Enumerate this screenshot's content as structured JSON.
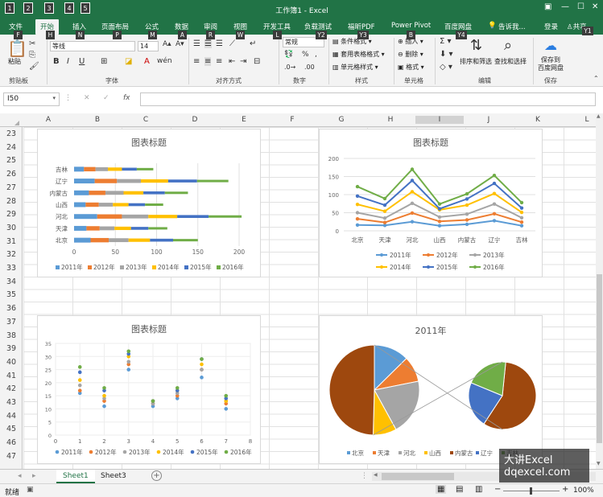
{
  "window": {
    "title": "工作簿1 - Excel",
    "quick_access_keys": [
      "1",
      "2",
      "3",
      "4",
      "5"
    ]
  },
  "tabs": [
    {
      "label": "文件",
      "key": "F"
    },
    {
      "label": "开始",
      "key": "H"
    },
    {
      "label": "插入",
      "key": "N"
    },
    {
      "label": "页面布局",
      "key": "P"
    },
    {
      "label": "公式",
      "key": "M"
    },
    {
      "label": "数据",
      "key": "A"
    },
    {
      "label": "审阅",
      "key": "R"
    },
    {
      "label": "视图",
      "key": "W"
    },
    {
      "label": "开发工具",
      "key": "L"
    },
    {
      "label": "负载测试",
      "key": "Y2"
    },
    {
      "label": "福昕PDF",
      "key": "Y3"
    },
    {
      "label": "Power Pivot",
      "key": "B"
    },
    {
      "label": "百度网盘",
      "key": "Y4"
    }
  ],
  "tell_me": "告诉我...",
  "login": "登录",
  "share": "共享",
  "share_key": "Y1",
  "ribbon": {
    "clipboard": {
      "paste": "粘贴",
      "label": "剪贴板"
    },
    "font": {
      "name": "等线",
      "size": "14",
      "label": "字体"
    },
    "align": {
      "label": "对齐方式"
    },
    "number": {
      "format": "常规",
      "label": "数字"
    },
    "styles": {
      "cond": "条件格式",
      "table": "套用表格格式",
      "cell": "单元格样式",
      "label": "样式"
    },
    "cells": {
      "insert": "插入",
      "delete": "删除",
      "format": "格式",
      "label": "单元格"
    },
    "edit": {
      "sort": "排序和筛选",
      "find": "查找和选择",
      "label": "编辑"
    },
    "save": {
      "btn": "保存到\n百度网盘",
      "label": "保存"
    }
  },
  "namebox": "I50",
  "columns": [
    "A",
    "B",
    "C",
    "D",
    "E",
    "F",
    "G",
    "H",
    "I",
    "J",
    "K",
    "L"
  ],
  "rows": [
    "23",
    "24",
    "25",
    "26",
    "27",
    "28",
    "29",
    "30",
    "31",
    "32",
    "33",
    "34",
    "35",
    "36",
    "37",
    "38",
    "39",
    "40",
    "41",
    "42",
    "43",
    "44",
    "45",
    "46",
    "47"
  ],
  "sheets": [
    "Sheet1",
    "Sheet3"
  ],
  "status": {
    "ready": "就绪",
    "zoom": "100%"
  },
  "watermark": {
    "line1": "大讲Excel",
    "line2": "dqexcel.com"
  },
  "chart_data": [
    {
      "type": "bar",
      "stacked": true,
      "title": "图表标题",
      "categories": [
        "吉林",
        "辽宁",
        "内蒙古",
        "山西",
        "河北",
        "天津",
        "北京"
      ],
      "xlim": [
        0,
        200
      ],
      "xticks": [
        "0",
        "50",
        "100",
        "150",
        "200"
      ],
      "series": [
        {
          "name": "2011年",
          "color": "#5b9bd5",
          "values": [
            12,
            25,
            18,
            14,
            28,
            15,
            20
          ]
        },
        {
          "name": "2012年",
          "color": "#ed7d31",
          "values": [
            14,
            27,
            20,
            16,
            30,
            16,
            22
          ]
        },
        {
          "name": "2013年",
          "color": "#a5a5a5",
          "values": [
            15,
            29,
            22,
            17,
            32,
            18,
            24
          ]
        },
        {
          "name": "2014年",
          "color": "#ffc000",
          "values": [
            17,
            33,
            24,
            19,
            35,
            20,
            26
          ]
        },
        {
          "name": "2015年",
          "color": "#4472c4",
          "values": [
            18,
            35,
            26,
            20,
            38,
            21,
            28
          ]
        },
        {
          "name": "2016年",
          "color": "#70ad47",
          "values": [
            20,
            38,
            28,
            22,
            40,
            23,
            30
          ]
        }
      ]
    },
    {
      "type": "line",
      "title": "图表标题",
      "categories": [
        "北京",
        "天津",
        "河北",
        "山西",
        "内蒙古",
        "辽宁",
        "吉林"
      ],
      "ylim": [
        0,
        200
      ],
      "yticks": [
        "0",
        "50",
        "100",
        "150",
        "200"
      ],
      "series": [
        {
          "name": "2011年",
          "color": "#5b9bd5",
          "values": [
            16,
            15,
            25,
            14,
            18,
            28,
            14
          ]
        },
        {
          "name": "2012年",
          "color": "#ed7d31",
          "values": [
            33,
            23,
            49,
            26,
            30,
            47,
            24
          ]
        },
        {
          "name": "2013年",
          "color": "#a5a5a5",
          "values": [
            50,
            35,
            76,
            38,
            46,
            74,
            36
          ]
        },
        {
          "name": "2014年",
          "color": "#ffc000",
          "values": [
            73,
            54,
            108,
            58,
            71,
            103,
            51
          ]
        },
        {
          "name": "2015年",
          "color": "#4472c4",
          "values": [
            96,
            71,
            139,
            61,
            88,
            131,
            63
          ]
        },
        {
          "name": "2016年",
          "color": "#70ad47",
          "values": [
            122,
            89,
            170,
            74,
            102,
            153,
            78
          ]
        }
      ]
    },
    {
      "type": "scatter",
      "title": "图表标题",
      "xlim": [
        0,
        8
      ],
      "ylim": [
        0,
        35
      ],
      "xticks": [
        "0",
        "1",
        "2",
        "3",
        "4",
        "5",
        "6",
        "7",
        "8"
      ],
      "yticks": [
        "0",
        "5",
        "10",
        "15",
        "20",
        "25",
        "30",
        "35"
      ],
      "series": [
        {
          "name": "2011年",
          "color": "#5b9bd5",
          "x": [
            1,
            2,
            3,
            4,
            5,
            6,
            7
          ],
          "y": [
            16,
            11,
            25,
            11,
            14,
            22,
            10
          ]
        },
        {
          "name": "2012年",
          "color": "#ed7d31",
          "x": [
            1,
            2,
            3,
            4,
            5,
            6,
            7
          ],
          "y": [
            17,
            13,
            27,
            12,
            15,
            25,
            12
          ]
        },
        {
          "name": "2013年",
          "color": "#a5a5a5",
          "x": [
            1,
            2,
            3,
            4,
            5,
            6,
            7
          ],
          "y": [
            19,
            14,
            28,
            12,
            16,
            25,
            13
          ]
        },
        {
          "name": "2014年",
          "color": "#ffc000",
          "x": [
            1,
            2,
            3,
            4,
            5,
            6,
            7
          ],
          "y": [
            21,
            15,
            30,
            13,
            17,
            27,
            13
          ]
        },
        {
          "name": "2015年",
          "color": "#4472c4",
          "x": [
            1,
            2,
            3,
            4,
            5,
            6,
            7
          ],
          "y": [
            24,
            17,
            31,
            13,
            17,
            29,
            14
          ]
        },
        {
          "name": "2016年",
          "color": "#70ad47",
          "x": [
            1,
            2,
            3,
            4,
            5,
            6,
            7
          ],
          "y": [
            26,
            18,
            32,
            13,
            18,
            29,
            15
          ]
        }
      ]
    },
    {
      "type": "pie",
      "title": "2011年",
      "categories": [
        "北京",
        "天津",
        "河北",
        "山西",
        "内蒙古",
        "辽宁",
        "吉林"
      ],
      "values": [
        15,
        11,
        24,
        10,
        34,
        13,
        12
      ],
      "colors": [
        "#5b9bd5",
        "#ed7d31",
        "#a5a5a5",
        "#ffc000",
        "#9e480e",
        "#4472c4",
        "#70ad47"
      ]
    }
  ]
}
